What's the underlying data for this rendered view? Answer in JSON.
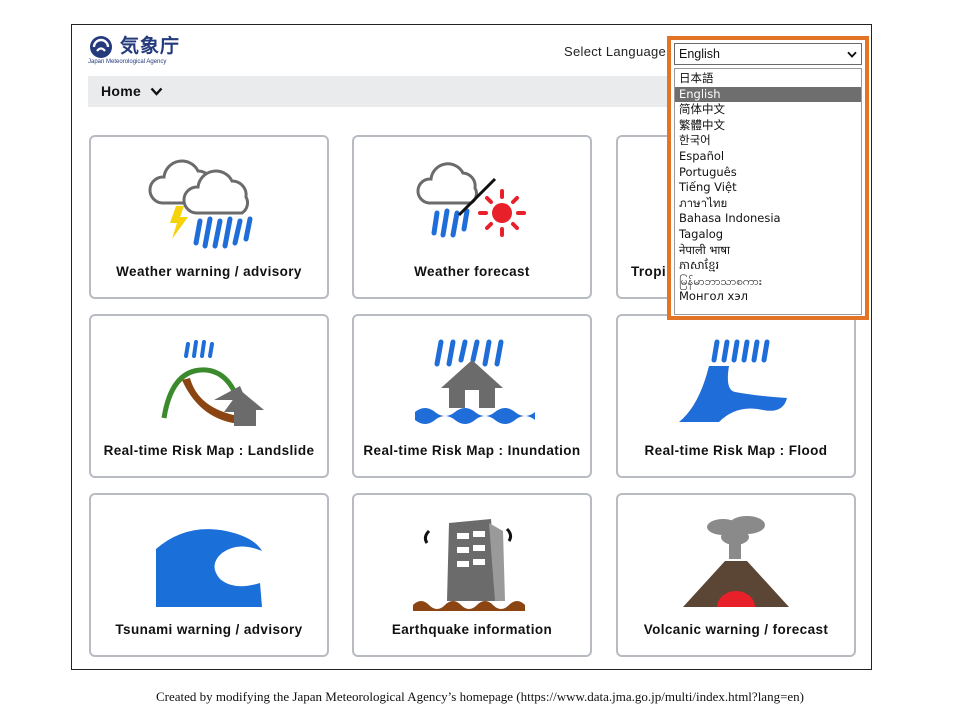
{
  "header": {
    "logo_ja": "気象庁",
    "logo_en": "Japan Meteorological Agency",
    "language_label": "Select Language"
  },
  "nav": {
    "home_label": "Home"
  },
  "tiles": [
    {
      "label": "Weather warning / advisory",
      "icon": "thunderstorm-icon"
    },
    {
      "label": "Weather forecast",
      "icon": "weather-forecast-icon"
    },
    {
      "label": "Tropi",
      "icon": "tropical-cyclone-icon"
    },
    {
      "label": "Real-time Risk Map : Landslide",
      "icon": "landslide-icon"
    },
    {
      "label": "Real-time Risk Map : Inundation",
      "icon": "inundation-icon"
    },
    {
      "label": "Real-time Risk Map : Flood",
      "icon": "flood-icon"
    },
    {
      "label": "Tsunami warning / advisory",
      "icon": "tsunami-icon"
    },
    {
      "label": "Earthquake information",
      "icon": "earthquake-icon"
    },
    {
      "label": "Volcanic warning / forecast",
      "icon": "volcano-icon"
    }
  ],
  "language_select": {
    "current": "English",
    "options": [
      "日本語",
      "English",
      "简体中文",
      "繁體中文",
      "한국어",
      "Español",
      "Português",
      "Tiếng Việt",
      "ภาษาไทย",
      "Bahasa Indonesia",
      "Tagalog",
      "नेपाली भाषा",
      "ភាសាខ្មែរ",
      "မြန်မာဘာသာစကား",
      "Монгол хэл"
    ],
    "selected_index": 1
  },
  "colors": {
    "highlight_border": "#e37425",
    "navbar_bg": "#eaebed",
    "tile_border": "#b8bcc2"
  },
  "caption": "Created by modifying the Japan Meteorological Agency’s homepage (https://www.data.jma.go.jp/multi/index.html?lang=en)"
}
